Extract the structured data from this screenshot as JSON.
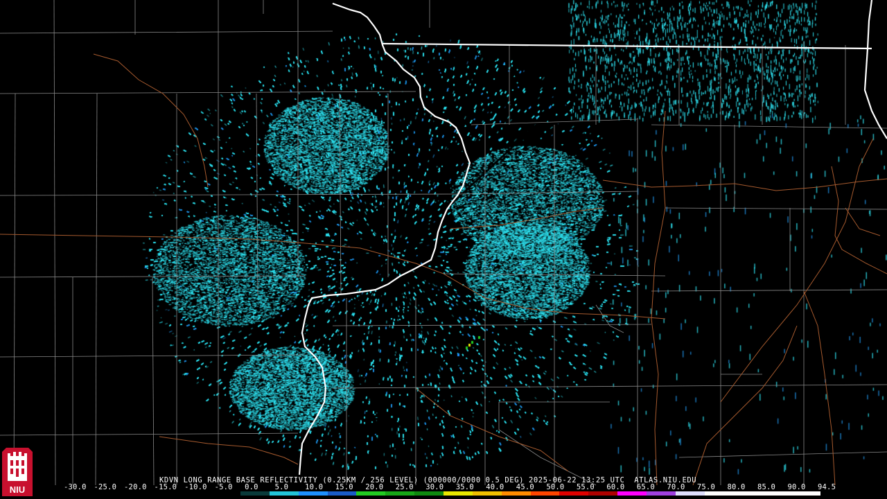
{
  "map": {
    "title": "KDVN LONG RANGE BASE REFLECTIVITY (0.25KM / 256 LEVEL) (000000/0000 0.5 DEG) 2025-06-22 13:25 UTC  ATLAS.NIU.EDU",
    "logo_text": "NIU",
    "colors": {
      "background": "#000000",
      "state_border": "#ffffff",
      "county_border": "#8a8a8a",
      "highway": "#a65a2e",
      "echo_primary": "#2ee0ee",
      "echo_secondary": "#1f8fe0",
      "logo_red": "#c8102e"
    },
    "scale": {
      "labels": [
        "-30.0",
        "-25.0",
        "-20.0",
        "-15.0",
        "-10.0",
        "-5.0",
        "0.0",
        "5.0",
        "10.0",
        "15.0",
        "20.0",
        "25.0",
        "30.0",
        "35.0",
        "40.0",
        "45.0",
        "50.0",
        "55.0",
        "60.0",
        "65.0",
        "70.0",
        "75.0",
        "80.0",
        "85.0",
        "90.0",
        "94.5"
      ],
      "colors": [
        "#000000",
        "#000000",
        "#000000",
        "#000000",
        "#000000",
        "#000000",
        "#0a3a3a",
        "#22c4d8",
        "#1e90ff",
        "#1a5cc8",
        "#22cc22",
        "#17a817",
        "#0f8a0f",
        "#e8e800",
        "#f0c000",
        "#ff8c00",
        "#ff4500",
        "#e00000",
        "#b00000",
        "#ff00ff",
        "#a040e0",
        "#e0e0ff",
        "#ffffff",
        "#ffffff",
        "#ffffff",
        "#ffffff"
      ]
    }
  }
}
